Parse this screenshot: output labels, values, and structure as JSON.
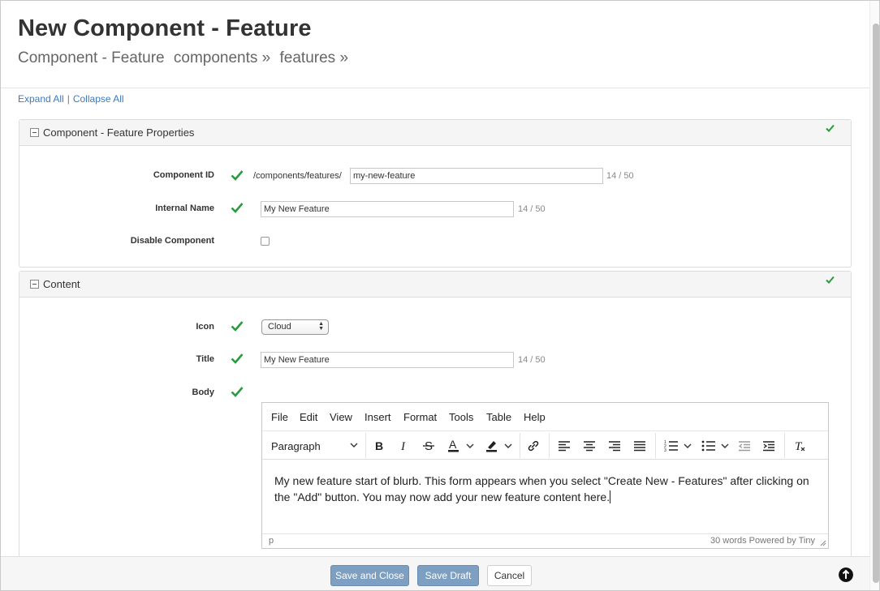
{
  "header": {
    "title": "New Component - Feature",
    "breadcrumb": [
      "Component - Feature",
      "components »",
      "features »"
    ]
  },
  "expand": {
    "expand_all": "Expand All",
    "separator": "|",
    "collapse_all": "Collapse All"
  },
  "properties": {
    "section_title": "Component - Feature Properties",
    "component_id": {
      "label": "Component ID",
      "prefix": "/components/features/",
      "value": "my-new-feature",
      "counter": "14 / 50"
    },
    "internal_name": {
      "label": "Internal Name",
      "value": "My New Feature",
      "counter": "14 / 50"
    },
    "disable": {
      "label": "Disable Component",
      "checked": false
    }
  },
  "content": {
    "section_title": "Content",
    "icon": {
      "label": "Icon",
      "value": "Cloud"
    },
    "title": {
      "label": "Title",
      "value": "My New Feature",
      "counter": "14 / 50"
    },
    "body": {
      "label": "Body"
    }
  },
  "editor": {
    "menu": [
      "File",
      "Edit",
      "View",
      "Insert",
      "Format",
      "Tools",
      "Table",
      "Help"
    ],
    "block_format": "Paragraph",
    "text": "My new feature start of blurb.  This form appears when you select \"Create New - Features\" after clicking on the \"Add\" button.  You may now add your new feature content here.",
    "status_path": "p",
    "status_words": "30 words  Powered by Tiny"
  },
  "footer": {
    "save_close": "Save and Close",
    "save_draft": "Save Draft",
    "cancel": "Cancel"
  },
  "colors": {
    "accent": "#7d9fc2",
    "link": "#3d7ab8",
    "check": "#2a9a3e"
  }
}
